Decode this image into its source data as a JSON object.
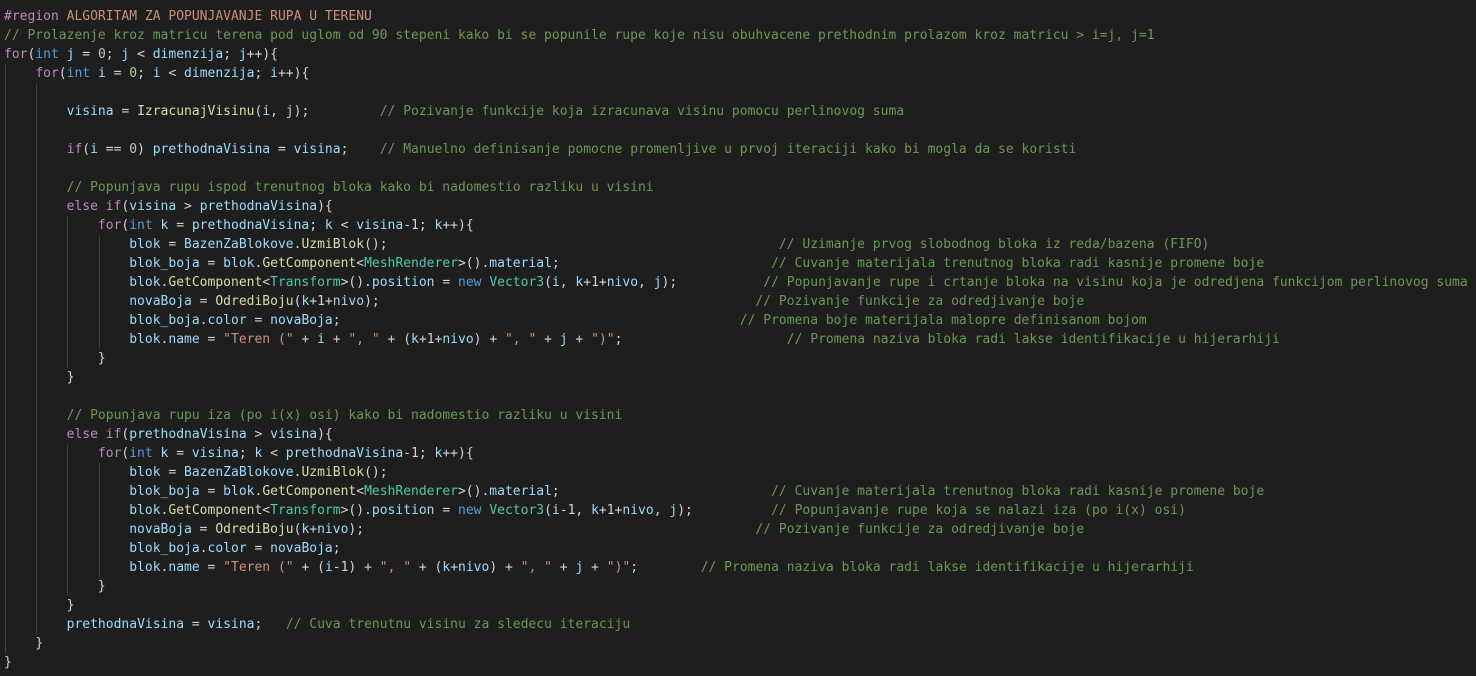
{
  "theme": {
    "background": "#1e1e1e",
    "default_text": "#d4d4d4",
    "colors": {
      "keyword": "#569cd6",
      "control": "#c586c0",
      "variable": "#9cdcfe",
      "function": "#dcdcaa",
      "type": "#4ec9b0",
      "number": "#b5cea8",
      "string": "#ce9178",
      "comment": "#6a9955"
    }
  },
  "lines": [
    {
      "indent": 0,
      "tokens": [
        [
          "region",
          "#region"
        ],
        [
          "op",
          " "
        ],
        [
          "regname",
          "ALGORITAM ZA POPUNJAVANJE RUPA U TERENU"
        ]
      ]
    },
    {
      "indent": 0,
      "tokens": [
        [
          "cmt",
          "// Prolazenje kroz matricu terena pod uglom od 90 stepeni kako bi se popunile rupe koje nisu obuhvacene prethodnim prolazom kroz matricu > i=j, j=1"
        ]
      ]
    },
    {
      "indent": 0,
      "tokens": [
        [
          "ctl",
          "for"
        ],
        [
          "op",
          "("
        ],
        [
          "kw",
          "int"
        ],
        [
          "op",
          " "
        ],
        [
          "var",
          "j"
        ],
        [
          "op",
          " = "
        ],
        [
          "num",
          "0"
        ],
        [
          "op",
          "; "
        ],
        [
          "var",
          "j"
        ],
        [
          "op",
          " < "
        ],
        [
          "var",
          "dimenzija"
        ],
        [
          "op",
          "; "
        ],
        [
          "var",
          "j"
        ],
        [
          "op",
          "++){"
        ]
      ]
    },
    {
      "indent": 1,
      "tokens": [
        [
          "ctl",
          "for"
        ],
        [
          "op",
          "("
        ],
        [
          "kw",
          "int"
        ],
        [
          "op",
          " "
        ],
        [
          "var",
          "i"
        ],
        [
          "op",
          " = "
        ],
        [
          "num",
          "0"
        ],
        [
          "op",
          "; "
        ],
        [
          "var",
          "i"
        ],
        [
          "op",
          " < "
        ],
        [
          "var",
          "dimenzija"
        ],
        [
          "op",
          "; "
        ],
        [
          "var",
          "i"
        ],
        [
          "op",
          "++){"
        ]
      ]
    },
    {
      "indent": 2,
      "tokens": []
    },
    {
      "indent": 2,
      "tokens": [
        [
          "var",
          "visina"
        ],
        [
          "op",
          " = "
        ],
        [
          "fn",
          "IzracunajVisinu"
        ],
        [
          "op",
          "("
        ],
        [
          "var",
          "i"
        ],
        [
          "op",
          ", "
        ],
        [
          "var",
          "j"
        ],
        [
          "op",
          ");         "
        ],
        [
          "cmt",
          "// Pozivanje funkcije koja izracunava visinu pomocu perlinovog suma"
        ]
      ]
    },
    {
      "indent": 2,
      "tokens": []
    },
    {
      "indent": 2,
      "tokens": [
        [
          "ctl",
          "if"
        ],
        [
          "op",
          "("
        ],
        [
          "var",
          "i"
        ],
        [
          "op",
          " == "
        ],
        [
          "num",
          "0"
        ],
        [
          "op",
          ") "
        ],
        [
          "var",
          "prethodnaVisina"
        ],
        [
          "op",
          " = "
        ],
        [
          "var",
          "visina"
        ],
        [
          "op",
          ";    "
        ],
        [
          "cmt",
          "// Manuelno definisanje pomocne promenljive u prvoj iteraciji kako bi mogla da se koristi"
        ]
      ]
    },
    {
      "indent": 2,
      "tokens": []
    },
    {
      "indent": 2,
      "tokens": [
        [
          "cmt",
          "// Popunjava rupu ispod trenutnog bloka kako bi nadomestio razliku u visini"
        ]
      ]
    },
    {
      "indent": 2,
      "tokens": [
        [
          "ctl",
          "else"
        ],
        [
          "op",
          " "
        ],
        [
          "ctl",
          "if"
        ],
        [
          "op",
          "("
        ],
        [
          "var",
          "visina"
        ],
        [
          "op",
          " > "
        ],
        [
          "var",
          "prethodnaVisina"
        ],
        [
          "op",
          "){"
        ]
      ]
    },
    {
      "indent": 3,
      "tokens": [
        [
          "ctl",
          "for"
        ],
        [
          "op",
          "("
        ],
        [
          "kw",
          "int"
        ],
        [
          "op",
          " "
        ],
        [
          "var",
          "k"
        ],
        [
          "op",
          " = "
        ],
        [
          "var",
          "prethodnaVisina"
        ],
        [
          "op",
          "; "
        ],
        [
          "var",
          "k"
        ],
        [
          "op",
          " < "
        ],
        [
          "var",
          "visina"
        ],
        [
          "op",
          "-1; "
        ],
        [
          "var",
          "k"
        ],
        [
          "op",
          "++){"
        ]
      ]
    },
    {
      "indent": 4,
      "tokens": [
        [
          "var",
          "blok"
        ],
        [
          "op",
          " = "
        ],
        [
          "var",
          "BazenZaBlokove"
        ],
        [
          "op",
          "."
        ],
        [
          "fn",
          "UzmiBlok"
        ],
        [
          "op",
          "();                                                  "
        ],
        [
          "cmt",
          "// Uzimanje prvog slobodnog bloka iz reda/bazena (FIFO)"
        ]
      ]
    },
    {
      "indent": 4,
      "tokens": [
        [
          "var",
          "blok_boja"
        ],
        [
          "op",
          " = "
        ],
        [
          "var",
          "blok"
        ],
        [
          "op",
          "."
        ],
        [
          "fn",
          "GetComponent"
        ],
        [
          "op",
          "<"
        ],
        [
          "type",
          "MeshRenderer"
        ],
        [
          "op",
          ">()."
        ],
        [
          "var",
          "material"
        ],
        [
          "op",
          ";                           "
        ],
        [
          "cmt",
          "// Cuvanje materijala trenutnog bloka radi kasnije promene boje"
        ]
      ]
    },
    {
      "indent": 4,
      "tokens": [
        [
          "var",
          "blok"
        ],
        [
          "op",
          "."
        ],
        [
          "fn",
          "GetComponent"
        ],
        [
          "op",
          "<"
        ],
        [
          "type",
          "Transform"
        ],
        [
          "op",
          ">()."
        ],
        [
          "var",
          "position"
        ],
        [
          "op",
          " = "
        ],
        [
          "kw",
          "new"
        ],
        [
          "op",
          " "
        ],
        [
          "type",
          "Vector3"
        ],
        [
          "op",
          "("
        ],
        [
          "var",
          "i"
        ],
        [
          "op",
          ", "
        ],
        [
          "var",
          "k"
        ],
        [
          "op",
          "+1+"
        ],
        [
          "var",
          "nivo"
        ],
        [
          "op",
          ", "
        ],
        [
          "var",
          "j"
        ],
        [
          "op",
          ");           "
        ],
        [
          "cmt",
          "// Popunjavanje rupe i crtanje bloka na visinu koja je odredjena funkcijom perlinovog suma"
        ]
      ]
    },
    {
      "indent": 4,
      "tokens": [
        [
          "var",
          "novaBoja"
        ],
        [
          "op",
          " = "
        ],
        [
          "fn",
          "OdrediBoju"
        ],
        [
          "op",
          "("
        ],
        [
          "var",
          "k"
        ],
        [
          "op",
          "+1+"
        ],
        [
          "var",
          "nivo"
        ],
        [
          "op",
          ");                                                "
        ],
        [
          "cmt",
          "// Pozivanje funkcije za odredjivanje boje"
        ]
      ]
    },
    {
      "indent": 4,
      "tokens": [
        [
          "var",
          "blok_boja"
        ],
        [
          "op",
          "."
        ],
        [
          "var",
          "color"
        ],
        [
          "op",
          " = "
        ],
        [
          "var",
          "novaBoja"
        ],
        [
          "op",
          ";                                                   "
        ],
        [
          "cmt",
          "// Promena boje materijala malopre definisanom bojom"
        ]
      ]
    },
    {
      "indent": 4,
      "tokens": [
        [
          "var",
          "blok"
        ],
        [
          "op",
          "."
        ],
        [
          "var",
          "name"
        ],
        [
          "op",
          " = "
        ],
        [
          "str",
          "\"Teren (\""
        ],
        [
          "op",
          " + "
        ],
        [
          "var",
          "i"
        ],
        [
          "op",
          " + "
        ],
        [
          "str",
          "\", \""
        ],
        [
          "op",
          " + ("
        ],
        [
          "var",
          "k"
        ],
        [
          "op",
          "+1+"
        ],
        [
          "var",
          "nivo"
        ],
        [
          "op",
          ") + "
        ],
        [
          "str",
          "\", \""
        ],
        [
          "op",
          " + "
        ],
        [
          "var",
          "j"
        ],
        [
          "op",
          " + "
        ],
        [
          "str",
          "\")\""
        ],
        [
          "op",
          ";                     "
        ],
        [
          "cmt",
          "// Promena naziva bloka radi lakse identifikacije u hijerarhiji"
        ]
      ]
    },
    {
      "indent": 3,
      "tokens": [
        [
          "op",
          "}"
        ]
      ]
    },
    {
      "indent": 2,
      "tokens": [
        [
          "op",
          "}"
        ]
      ]
    },
    {
      "indent": 2,
      "tokens": []
    },
    {
      "indent": 2,
      "tokens": [
        [
          "cmt",
          "// Popunjava rupu iza (po i(x) osi) kako bi nadomestio razliku u visini"
        ]
      ]
    },
    {
      "indent": 2,
      "tokens": [
        [
          "ctl",
          "else"
        ],
        [
          "op",
          " "
        ],
        [
          "ctl",
          "if"
        ],
        [
          "op",
          "("
        ],
        [
          "var",
          "prethodnaVisina"
        ],
        [
          "op",
          " > "
        ],
        [
          "var",
          "visina"
        ],
        [
          "op",
          "){"
        ]
      ]
    },
    {
      "indent": 3,
      "tokens": [
        [
          "ctl",
          "for"
        ],
        [
          "op",
          "("
        ],
        [
          "kw",
          "int"
        ],
        [
          "op",
          " "
        ],
        [
          "var",
          "k"
        ],
        [
          "op",
          " = "
        ],
        [
          "var",
          "visina"
        ],
        [
          "op",
          "; "
        ],
        [
          "var",
          "k"
        ],
        [
          "op",
          " < "
        ],
        [
          "var",
          "prethodnaVisina"
        ],
        [
          "op",
          "-1; "
        ],
        [
          "var",
          "k"
        ],
        [
          "op",
          "++){"
        ]
      ]
    },
    {
      "indent": 4,
      "tokens": [
        [
          "var",
          "blok"
        ],
        [
          "op",
          " = "
        ],
        [
          "var",
          "BazenZaBlokove"
        ],
        [
          "op",
          "."
        ],
        [
          "fn",
          "UzmiBlok"
        ],
        [
          "op",
          "();"
        ]
      ]
    },
    {
      "indent": 4,
      "tokens": [
        [
          "var",
          "blok_boja"
        ],
        [
          "op",
          " = "
        ],
        [
          "var",
          "blok"
        ],
        [
          "op",
          "."
        ],
        [
          "fn",
          "GetComponent"
        ],
        [
          "op",
          "<"
        ],
        [
          "type",
          "MeshRenderer"
        ],
        [
          "op",
          ">()."
        ],
        [
          "var",
          "material"
        ],
        [
          "op",
          ";                           "
        ],
        [
          "cmt",
          "// Cuvanje materijala trenutnog bloka radi kasnije promene boje"
        ]
      ]
    },
    {
      "indent": 4,
      "tokens": [
        [
          "var",
          "blok"
        ],
        [
          "op",
          "."
        ],
        [
          "fn",
          "GetComponent"
        ],
        [
          "op",
          "<"
        ],
        [
          "type",
          "Transform"
        ],
        [
          "op",
          ">()."
        ],
        [
          "var",
          "position"
        ],
        [
          "op",
          " = "
        ],
        [
          "kw",
          "new"
        ],
        [
          "op",
          " "
        ],
        [
          "type",
          "Vector3"
        ],
        [
          "op",
          "("
        ],
        [
          "var",
          "i"
        ],
        [
          "op",
          "-1, "
        ],
        [
          "var",
          "k"
        ],
        [
          "op",
          "+1+"
        ],
        [
          "var",
          "nivo"
        ],
        [
          "op",
          ", "
        ],
        [
          "var",
          "j"
        ],
        [
          "op",
          ");          "
        ],
        [
          "cmt",
          "// Popunjavanje rupe koja se nalazi iza (po i(x) osi)"
        ]
      ]
    },
    {
      "indent": 4,
      "tokens": [
        [
          "var",
          "novaBoja"
        ],
        [
          "op",
          " = "
        ],
        [
          "fn",
          "OdrediBoju"
        ],
        [
          "op",
          "("
        ],
        [
          "var",
          "k"
        ],
        [
          "op",
          "+"
        ],
        [
          "var",
          "nivo"
        ],
        [
          "op",
          ");                                                  "
        ],
        [
          "cmt",
          "// Pozivanje funkcije za odredjivanje boje"
        ]
      ]
    },
    {
      "indent": 4,
      "tokens": [
        [
          "var",
          "blok_boja"
        ],
        [
          "op",
          "."
        ],
        [
          "var",
          "color"
        ],
        [
          "op",
          " = "
        ],
        [
          "var",
          "novaBoja"
        ],
        [
          "op",
          ";"
        ]
      ]
    },
    {
      "indent": 4,
      "tokens": [
        [
          "var",
          "blok"
        ],
        [
          "op",
          "."
        ],
        [
          "var",
          "name"
        ],
        [
          "op",
          " = "
        ],
        [
          "str",
          "\"Teren (\""
        ],
        [
          "op",
          " + ("
        ],
        [
          "var",
          "i"
        ],
        [
          "op",
          "-1) + "
        ],
        [
          "str",
          "\", \""
        ],
        [
          "op",
          " + ("
        ],
        [
          "var",
          "k"
        ],
        [
          "op",
          "+"
        ],
        [
          "var",
          "nivo"
        ],
        [
          "op",
          ") + "
        ],
        [
          "str",
          "\", \""
        ],
        [
          "op",
          " + "
        ],
        [
          "var",
          "j"
        ],
        [
          "op",
          " + "
        ],
        [
          "str",
          "\")\""
        ],
        [
          "op",
          ";        "
        ],
        [
          "cmt",
          "// Promena naziva bloka radi lakse identifikacije u hijerarhiji"
        ]
      ]
    },
    {
      "indent": 3,
      "tokens": [
        [
          "op",
          "}"
        ]
      ]
    },
    {
      "indent": 2,
      "tokens": [
        [
          "op",
          "}"
        ]
      ]
    },
    {
      "indent": 2,
      "tokens": [
        [
          "var",
          "prethodnaVisina"
        ],
        [
          "op",
          " = "
        ],
        [
          "var",
          "visina"
        ],
        [
          "op",
          ";   "
        ],
        [
          "cmt",
          "// Cuva trenutnu visinu za sledecu iteraciju"
        ]
      ]
    },
    {
      "indent": 1,
      "tokens": [
        [
          "op",
          "}"
        ]
      ]
    },
    {
      "indent": 0,
      "tokens": [
        [
          "op",
          "}"
        ]
      ]
    }
  ]
}
